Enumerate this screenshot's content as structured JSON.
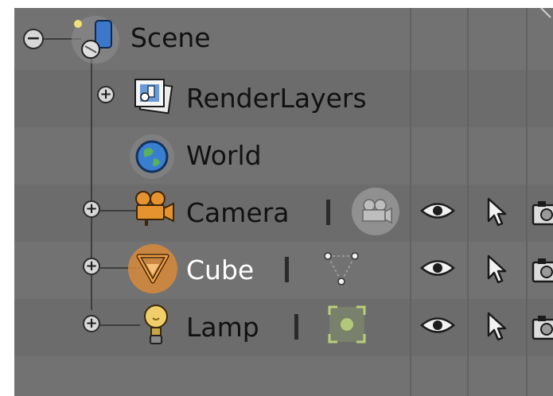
{
  "outliner": {
    "items": [
      {
        "id": "scene",
        "label": "Scene",
        "icon": "scene-icon",
        "expander": "−"
      },
      {
        "id": "renderlayers",
        "label": "RenderLayers",
        "icon": "renderlayers-icon",
        "expander": "+"
      },
      {
        "id": "world",
        "label": "World",
        "icon": "world-icon"
      },
      {
        "id": "camera",
        "label": "Camera",
        "icon": "camera-icon",
        "expander": "+",
        "data_icon": "camera-data-icon"
      },
      {
        "id": "cube",
        "label": "Cube",
        "icon": "mesh-object-icon",
        "expander": "+",
        "data_icon": "mesh-data-icon",
        "selected": true
      },
      {
        "id": "lamp",
        "label": "Lamp",
        "icon": "lamp-icon",
        "expander": "+",
        "data_icon": "lamp-data-icon"
      }
    ],
    "restrict_icons": [
      "visibility-eye-icon",
      "selectability-cursor-icon",
      "render-camera-icon"
    ]
  },
  "colors": {
    "background": "#727272",
    "selected_highlight": "#e0943a",
    "selected_text": "#ffffff",
    "text": "#111111"
  }
}
